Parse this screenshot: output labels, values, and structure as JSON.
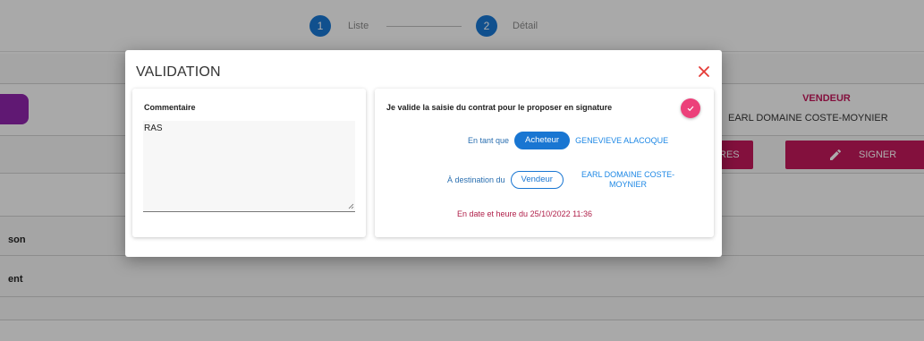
{
  "stepper": {
    "steps": [
      {
        "number": "1",
        "label": "Liste"
      },
      {
        "number": "2",
        "label": "Détail"
      }
    ]
  },
  "background": {
    "vendeur_title": "VENDEUR",
    "vendeur_name": "EARL DOMAINE COSTE-MOYNIER",
    "res_button": "RES",
    "sign_button": "SIGNER",
    "row_labels": [
      "son",
      "ent"
    ]
  },
  "modal": {
    "title": "VALIDATION",
    "close_icon": "close-icon",
    "comment_card": {
      "title": "Commentaire",
      "value": "RAS"
    },
    "validation_card": {
      "statement": "Je valide la saisie du contrat pour le proposer en signature",
      "as_label": "En tant que",
      "as_role": "Acheteur",
      "as_name": "GENEVIEVE ALACOQUE",
      "to_label": "À destination du",
      "to_role": "Vendeur",
      "to_name_line1": "EARL DOMAINE COSTE-",
      "to_name_line2": "MOYNIER",
      "date_text": "En date et heure du 25/10/2022 11:36",
      "check_icon": "check-icon"
    }
  },
  "colors": {
    "primary": "#1976d2",
    "accent": "#ec407a",
    "sign": "#c2185b",
    "purple": "#8e24aa",
    "close": "#e53935"
  }
}
